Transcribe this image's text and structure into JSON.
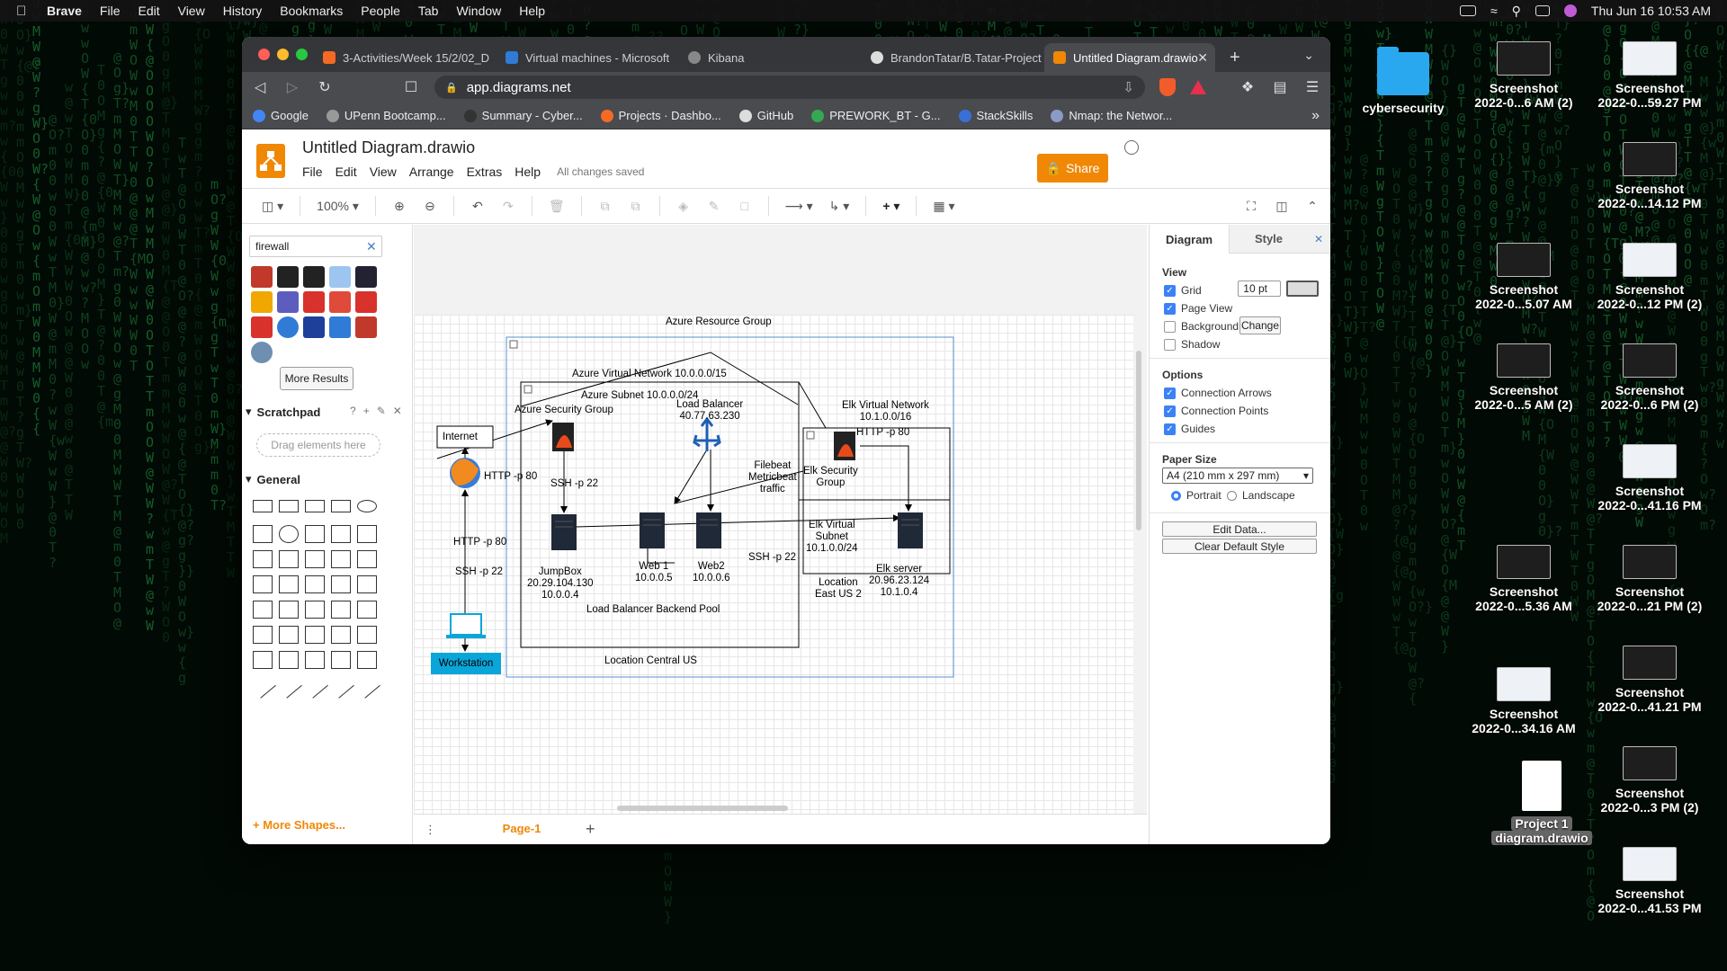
{
  "menubar": {
    "app": "Brave",
    "items": [
      "File",
      "Edit",
      "View",
      "History",
      "Bookmarks",
      "People",
      "Tab",
      "Window",
      "Help"
    ],
    "clock": "Thu Jun 16  10:53 AM"
  },
  "browser": {
    "tabs": [
      {
        "label": "3-Activities/Week 15/2/02_D",
        "color": "#f46a25"
      },
      {
        "label": "Virtual machines - Microsoft",
        "color": "#2f7bd6"
      },
      {
        "label": "Kibana",
        "color": "#888888"
      },
      {
        "label": "BrandonTatar/B.Tatar-Project",
        "color": "#dddddd"
      },
      {
        "label": "Untitled Diagram.drawio",
        "color": "#f08705"
      }
    ],
    "url": "app.diagrams.net",
    "bookmarks": [
      {
        "label": "Google",
        "color": "#4285f4"
      },
      {
        "label": "UPenn Bootcamp...",
        "color": "#999999"
      },
      {
        "label": "Summary - Cyber...",
        "color": "#333333"
      },
      {
        "label": "Projects · Dashbo...",
        "color": "#f46a25"
      },
      {
        "label": "GitHub",
        "color": "#dddddd"
      },
      {
        "label": "PREWORK_BT - G...",
        "color": "#34a853"
      },
      {
        "label": "StackSkills",
        "color": "#3b6fd8"
      },
      {
        "label": "Nmap: the Networ...",
        "color": "#8a9bc8"
      }
    ]
  },
  "drawio": {
    "title": "Untitled Diagram.drawio",
    "menu": [
      "File",
      "Edit",
      "View",
      "Arrange",
      "Extras",
      "Help"
    ],
    "saved": "All changes saved",
    "share": "Share",
    "zoom": "100%",
    "search_value": "firewall",
    "more_results": "More Results",
    "scratchpad": "Scratchpad",
    "drag_hint": "Drag elements here",
    "general": "General",
    "more_shapes": "+ More Shapes...",
    "page_tab": "Page-1",
    "right": {
      "tab_diagram": "Diagram",
      "tab_style": "Style",
      "view": "View",
      "grid": "Grid",
      "grid_size": "10 pt",
      "page_view": "Page View",
      "background": "Background",
      "change": "Change",
      "shadow": "Shadow",
      "options": "Options",
      "connection_arrows": "Connection Arrows",
      "connection_points": "Connection Points",
      "guides": "Guides",
      "paper_size": "Paper Size",
      "paper_value": "A4 (210 mm x 297 mm)",
      "portrait": "Portrait",
      "landscape": "Landscape",
      "edit_data": "Edit Data...",
      "clear_style": "Clear Default Style"
    },
    "diagram": {
      "resource_group": "Azure Resource Group",
      "vnet": "Azure Virtual Network 10.0.0.0/15",
      "subnet": "Azure Subnet 10.0.0.0/24",
      "security_group": "Azure Security Group",
      "lb_name": "Load Balancer",
      "lb_ip": "40.77.63.230",
      "internet": "Internet",
      "http80_a": "HTTP -p 80",
      "ssh22_a": "SSH -p 22",
      "http80_b": "HTTP -p 80",
      "ssh22_b": "SSH -p 22",
      "filebeat_1": "Filebeat",
      "filebeat_2": "Metricbeat",
      "filebeat_3": "traffic",
      "jumpbox_1": "JumpBox",
      "jumpbox_2": "20.29.104.130",
      "jumpbox_3": "10.0.0.4",
      "web1_1": "Web 1",
      "web1_2": "10.0.0.5",
      "web2_1": "Web2",
      "web2_2": "10.0.0.6",
      "backend_pool": "Load Balancer Backend Pool",
      "ssh22_c": "SSH -p 22",
      "elk_vnet_1": "Elk Virtual Network",
      "elk_vnet_2": "10.1.0.0/16",
      "http80_c": "HTTP -p 80",
      "elk_sg_1": "Elk Security",
      "elk_sg_2": "Group",
      "elk_subnet_1": "Elk Virtual",
      "elk_subnet_2": "Subnet",
      "elk_subnet_3": "10.1.0.0/24",
      "elk_server_1": "Elk server",
      "elk_server_2": "20.96.23.124",
      "elk_server_3": "10.1.0.4",
      "loc_east_1": "Location",
      "loc_east_2": "East US 2",
      "loc_central": "Location Central US",
      "workstation": "Workstation"
    }
  },
  "desktop": {
    "folder": "cybersecurity",
    "icons": [
      {
        "l1": "Screenshot",
        "l2": "2022-0...6 AM (2)"
      },
      {
        "l1": "Screenshot",
        "l2": "2022-0...59.27 PM"
      },
      {
        "l1": "Screenshot",
        "l2": "2022-0...14.12 PM"
      },
      {
        "l1": "Screenshot",
        "l2": "2022-0...5.07 AM"
      },
      {
        "l1": "Screenshot",
        "l2": "2022-0...12 PM (2)"
      },
      {
        "l1": "Screenshot",
        "l2": "2022-0...5 AM (2)"
      },
      {
        "l1": "Screenshot",
        "l2": "2022-0...6 PM (2)"
      },
      {
        "l1": "Screenshot",
        "l2": "2022-0...41.16 PM"
      },
      {
        "l1": "Screenshot",
        "l2": "2022-0...5.36 AM"
      },
      {
        "l1": "Screenshot",
        "l2": "2022-0...21 PM (2)"
      },
      {
        "l1": "Screenshot",
        "l2": "2022-0...34.16 AM"
      },
      {
        "l1": "Screenshot",
        "l2": "2022-0...41.21 PM"
      },
      {
        "l1": "Screenshot",
        "l2": "2022-0...3 PM (2)"
      },
      {
        "l1": "Screenshot",
        "l2": "2022-0...41.53 PM"
      }
    ],
    "project_file_1": "Project 1",
    "project_file_2": "diagram.drawio"
  }
}
